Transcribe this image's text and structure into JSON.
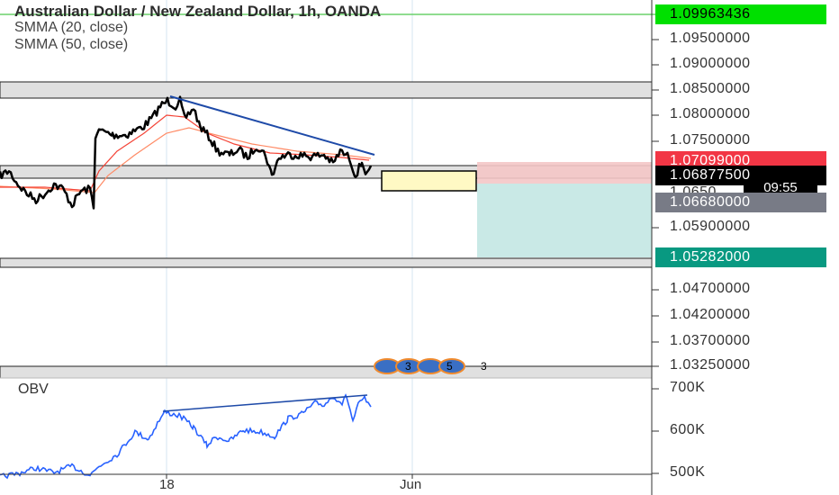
{
  "header": {
    "title": "Australian Dollar / New Zealand Dollar, 1h, OANDA",
    "indicator_1": "SMMA (20, close)",
    "indicator_2": "SMMA (50, close)"
  },
  "obv": {
    "label": "OBV"
  },
  "price_axis": {
    "labels": [
      "1.09500000",
      "1.09000000",
      "1.08500000",
      "1.08000000",
      "1.07500000",
      "1.05900000",
      "1.04700000",
      "1.04200000",
      "1.03700000",
      "1.03250000"
    ],
    "partial_label": "1.0650",
    "badges": [
      {
        "text": "1.09963436",
        "bg": "#00e000",
        "fg": "#000000"
      },
      {
        "text": "1.07099000",
        "bg": "#f23645",
        "fg": "#ffffff"
      },
      {
        "text": "1.06877500",
        "bg": "#000000",
        "fg": "#ffffff"
      },
      {
        "text": "1.06680000",
        "bg": "#787b86",
        "fg": "#ffffff"
      },
      {
        "text": "1.05282000",
        "bg": "#089981",
        "fg": "#ffffff"
      }
    ],
    "countdown": "09:55"
  },
  "obv_axis": {
    "labels": [
      "700K",
      "600K",
      "500K"
    ]
  },
  "time_axis": {
    "labels": [
      "18",
      "Jun"
    ]
  },
  "events": {
    "numbers": [
      "3",
      "5",
      "3"
    ]
  },
  "colors": {
    "price_line": "#000000",
    "smma_fast": "#f44336",
    "smma_slow": "#ff8a65",
    "trendline": "#1e4aa8",
    "obv_line": "#2962ff",
    "zone_fill": "#e0e0e0",
    "target_zone": "#b2dfdb",
    "stop_zone": "#f4c7c7",
    "entry_box": "#fff9c4",
    "crosshair_line": "#6bd06b"
  }
}
